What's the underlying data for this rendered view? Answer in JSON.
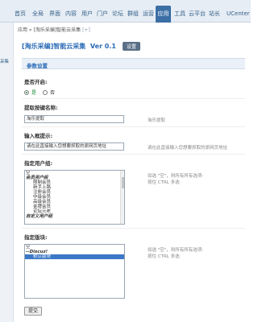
{
  "topnav": {
    "items": [
      {
        "label": "首页"
      },
      {
        "label": "全局"
      },
      {
        "label": "界面"
      },
      {
        "label": "内容"
      },
      {
        "label": "用户"
      },
      {
        "label": "门户"
      },
      {
        "label": "论坛"
      },
      {
        "label": "群组"
      },
      {
        "label": "运营"
      },
      {
        "label": "应用"
      },
      {
        "label": "工具"
      },
      {
        "label": "云平台"
      },
      {
        "label": "站长"
      },
      {
        "label": "UCenter"
      }
    ],
    "active_index": 9
  },
  "sidebar": {
    "item_label": "采集"
  },
  "breadcrumb": {
    "text": "应用 » [淘乐采编]智能云采集 ",
    "plus": "[+]"
  },
  "title": {
    "plugin_name": "[淘乐采编]智能云采集",
    "version": "Ver 0.1",
    "settings_button": "设置"
  },
  "section": {
    "title": "参数设置"
  },
  "fields": {
    "enabled": {
      "label": "是否开启:",
      "yes": "是",
      "no": "否",
      "value": "yes"
    },
    "nav_name": {
      "label": "提取按键名称:",
      "value": "淘乐提取",
      "hint": "淘乐提取"
    },
    "input_tip": {
      "label": "输入框提示:",
      "value": "请在此直接输入您想要抓取的原网页地址",
      "hint": "请在此直接输入您想要抓取的原网页地址"
    },
    "user_groups": {
      "label": "指定用户组:",
      "hint_line1": "如选 \"空\"，则所有所有选项-",
      "hint_line2": "按住 CTRL 多选",
      "options": [
        {
          "label": "空",
          "kind": "plain"
        },
        {
          "label": "会员用户组",
          "kind": "group"
        },
        {
          "label": "限制会员",
          "kind": "indent"
        },
        {
          "label": "新手上路",
          "kind": "indent"
        },
        {
          "label": "注册会员",
          "kind": "indent"
        },
        {
          "label": "中级会员",
          "kind": "indent"
        },
        {
          "label": "高级会员",
          "kind": "indent"
        },
        {
          "label": "金牌会员",
          "kind": "indent"
        },
        {
          "label": "论坛元老",
          "kind": "indent"
        },
        {
          "label": "自定义用户组",
          "kind": "group"
        }
      ]
    },
    "forums": {
      "label": "指定版块:",
      "hint_line1": "如选 \"空\"，则所有所有选项-",
      "hint_line2": "按住 CTRL 多选",
      "options": [
        {
          "label": "空",
          "kind": "plain"
        },
        {
          "label": "--Discuz!",
          "kind": "group"
        },
        {
          "label": "默认版块",
          "kind": "indent",
          "selected": true
        }
      ]
    }
  },
  "submit": {
    "label": "提交"
  }
}
